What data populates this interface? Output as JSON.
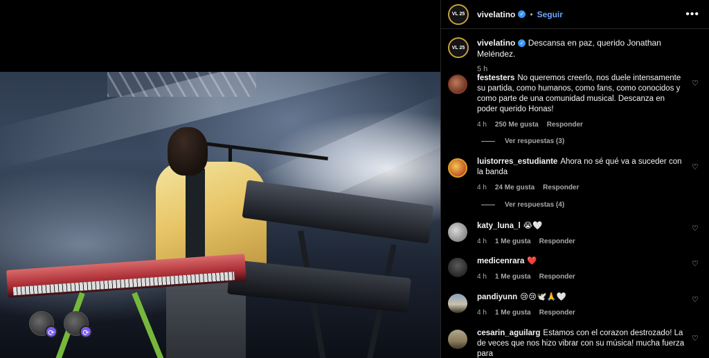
{
  "media": {
    "tag_badge_icon": "repost-icon"
  },
  "post": {
    "author": "vivelatino",
    "avatar_text": "VL 25",
    "follow_label": "Seguir",
    "dot": "•",
    "more_icon": "•••",
    "caption": "Descansa en paz, querido Jonathan Meléndez.",
    "caption_time": "5 h"
  },
  "comments": [
    {
      "user": "festesters",
      "text": "No queremos creerlo, nos duele intensamente su partida, como humanos, como fans, como conocidos y como parte de una comunidad musical. Descanza en poder querido Honas!",
      "time": "4 h",
      "likes": "250 Me gusta",
      "reply": "Responder",
      "view_replies": "Ver respuestas (3)"
    },
    {
      "user": "luistorres_estudiante",
      "text": "Ahora no sé qué va a suceder con la banda",
      "time": "4 h",
      "likes": "24 Me gusta",
      "reply": "Responder",
      "view_replies": "Ver respuestas (4)"
    },
    {
      "user": "katy_luna_l",
      "text": "😭🤍",
      "time": "4 h",
      "likes": "1 Me gusta",
      "reply": "Responder"
    },
    {
      "user": "medicenrara",
      "text": "❤️",
      "time": "4 h",
      "likes": "1 Me gusta",
      "reply": "Responder"
    },
    {
      "user": "pandiyunn",
      "text": "😢😢🕊️🙏🤍",
      "time": "4 h",
      "likes": "1 Me gusta",
      "reply": "Responder"
    },
    {
      "user": "cesarin_aguilarg",
      "text": "Estamos con el corazon destrozado! La de veces que nos hizo vibrar con su música! mucha fuerza para",
      "time": "",
      "likes": "",
      "reply": ""
    }
  ],
  "icons": {
    "heart": "♡",
    "verified": "✓"
  },
  "colors": {
    "follow": "#6fa6ff",
    "verified": "#3897f0",
    "background": "#000000",
    "muted": "#a8a8a8"
  }
}
